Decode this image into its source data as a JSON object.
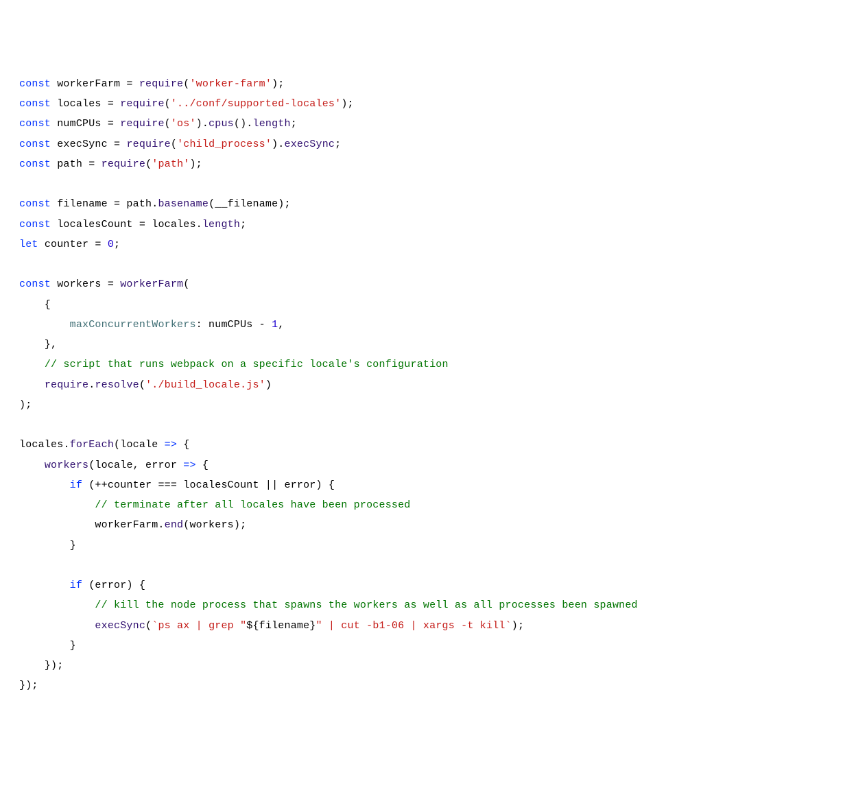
{
  "code": {
    "lines": [
      [
        {
          "t": "const ",
          "c": "kw"
        },
        {
          "t": "workerFarm = ",
          "c": "plain"
        },
        {
          "t": "require",
          "c": "fn"
        },
        {
          "t": "(",
          "c": "plain"
        },
        {
          "t": "'worker-farm'",
          "c": "str"
        },
        {
          "t": ");",
          "c": "plain"
        }
      ],
      [
        {
          "t": "const ",
          "c": "kw"
        },
        {
          "t": "locales = ",
          "c": "plain"
        },
        {
          "t": "require",
          "c": "fn"
        },
        {
          "t": "(",
          "c": "plain"
        },
        {
          "t": "'../conf/supported-locales'",
          "c": "str"
        },
        {
          "t": ");",
          "c": "plain"
        }
      ],
      [
        {
          "t": "const ",
          "c": "kw"
        },
        {
          "t": "numCPUs = ",
          "c": "plain"
        },
        {
          "t": "require",
          "c": "fn"
        },
        {
          "t": "(",
          "c": "plain"
        },
        {
          "t": "'os'",
          "c": "str"
        },
        {
          "t": ").",
          "c": "plain"
        },
        {
          "t": "cpus",
          "c": "fn"
        },
        {
          "t": "().",
          "c": "plain"
        },
        {
          "t": "length",
          "c": "fn"
        },
        {
          "t": ";",
          "c": "plain"
        }
      ],
      [
        {
          "t": "const ",
          "c": "kw"
        },
        {
          "t": "execSync = ",
          "c": "plain"
        },
        {
          "t": "require",
          "c": "fn"
        },
        {
          "t": "(",
          "c": "plain"
        },
        {
          "t": "'child_process'",
          "c": "str"
        },
        {
          "t": ").",
          "c": "plain"
        },
        {
          "t": "execSync",
          "c": "fn"
        },
        {
          "t": ";",
          "c": "plain"
        }
      ],
      [
        {
          "t": "const ",
          "c": "kw"
        },
        {
          "t": "path = ",
          "c": "plain"
        },
        {
          "t": "require",
          "c": "fn"
        },
        {
          "t": "(",
          "c": "plain"
        },
        {
          "t": "'path'",
          "c": "str"
        },
        {
          "t": ");",
          "c": "plain"
        }
      ],
      [
        {
          "t": " ",
          "c": "plain"
        }
      ],
      [
        {
          "t": "const ",
          "c": "kw"
        },
        {
          "t": "filename = path.",
          "c": "plain"
        },
        {
          "t": "basename",
          "c": "fn"
        },
        {
          "t": "(__filename);",
          "c": "plain"
        }
      ],
      [
        {
          "t": "const ",
          "c": "kw"
        },
        {
          "t": "localesCount = locales.",
          "c": "plain"
        },
        {
          "t": "length",
          "c": "fn"
        },
        {
          "t": ";",
          "c": "plain"
        }
      ],
      [
        {
          "t": "let ",
          "c": "kw"
        },
        {
          "t": "counter = ",
          "c": "plain"
        },
        {
          "t": "0",
          "c": "num"
        },
        {
          "t": ";",
          "c": "plain"
        }
      ],
      [
        {
          "t": " ",
          "c": "plain"
        }
      ],
      [
        {
          "t": "const ",
          "c": "kw"
        },
        {
          "t": "workers = ",
          "c": "plain"
        },
        {
          "t": "workerFarm",
          "c": "fn"
        },
        {
          "t": "(",
          "c": "plain"
        }
      ],
      [
        {
          "t": "    {",
          "c": "plain"
        }
      ],
      [
        {
          "t": "        ",
          "c": "plain"
        },
        {
          "t": "maxConcurrentWorkers",
          "c": "cls"
        },
        {
          "t": ": numCPUs - ",
          "c": "plain"
        },
        {
          "t": "1",
          "c": "num"
        },
        {
          "t": ",",
          "c": "plain"
        }
      ],
      [
        {
          "t": "    },",
          "c": "plain"
        }
      ],
      [
        {
          "t": "    ",
          "c": "plain"
        },
        {
          "t": "// script that runs webpack on a specific locale's configuration",
          "c": "cmt"
        }
      ],
      [
        {
          "t": "    ",
          "c": "plain"
        },
        {
          "t": "require",
          "c": "fn"
        },
        {
          "t": ".",
          "c": "plain"
        },
        {
          "t": "resolve",
          "c": "fn"
        },
        {
          "t": "(",
          "c": "plain"
        },
        {
          "t": "'./build_locale.js'",
          "c": "str"
        },
        {
          "t": ")",
          "c": "plain"
        }
      ],
      [
        {
          "t": ");",
          "c": "plain"
        }
      ],
      [
        {
          "t": " ",
          "c": "plain"
        }
      ],
      [
        {
          "t": "locales.",
          "c": "plain"
        },
        {
          "t": "forEach",
          "c": "fn"
        },
        {
          "t": "(locale ",
          "c": "plain"
        },
        {
          "t": "=>",
          "c": "kw"
        },
        {
          "t": " {",
          "c": "plain"
        }
      ],
      [
        {
          "t": "    ",
          "c": "plain"
        },
        {
          "t": "workers",
          "c": "fn"
        },
        {
          "t": "(locale, error ",
          "c": "plain"
        },
        {
          "t": "=>",
          "c": "kw"
        },
        {
          "t": " {",
          "c": "plain"
        }
      ],
      [
        {
          "t": "        ",
          "c": "plain"
        },
        {
          "t": "if",
          "c": "kw"
        },
        {
          "t": " (++counter === localesCount || error) {",
          "c": "plain"
        }
      ],
      [
        {
          "t": "            ",
          "c": "plain"
        },
        {
          "t": "// terminate after all locales have been processed",
          "c": "cmt"
        }
      ],
      [
        {
          "t": "            workerFarm.",
          "c": "plain"
        },
        {
          "t": "end",
          "c": "fn"
        },
        {
          "t": "(workers);",
          "c": "plain"
        }
      ],
      [
        {
          "t": "        }",
          "c": "plain"
        }
      ],
      [
        {
          "t": " ",
          "c": "plain"
        }
      ],
      [
        {
          "t": "        ",
          "c": "plain"
        },
        {
          "t": "if",
          "c": "kw"
        },
        {
          "t": " (error) {",
          "c": "plain"
        }
      ],
      [
        {
          "t": "            ",
          "c": "plain"
        },
        {
          "t": "// kill the node process that spawns the workers as well as all processes been spawned",
          "c": "cmt"
        }
      ],
      [
        {
          "t": "            ",
          "c": "plain"
        },
        {
          "t": "execSync",
          "c": "fn"
        },
        {
          "t": "(",
          "c": "plain"
        },
        {
          "t": "`ps ax | grep \"",
          "c": "str"
        },
        {
          "t": "${filename}",
          "c": "plain"
        },
        {
          "t": "\" | cut -b1-06 | xargs -t kill`",
          "c": "str"
        },
        {
          "t": ");",
          "c": "plain"
        }
      ],
      [
        {
          "t": "        }",
          "c": "plain"
        }
      ],
      [
        {
          "t": "    });",
          "c": "plain"
        }
      ],
      [
        {
          "t": "});",
          "c": "plain"
        }
      ]
    ]
  }
}
